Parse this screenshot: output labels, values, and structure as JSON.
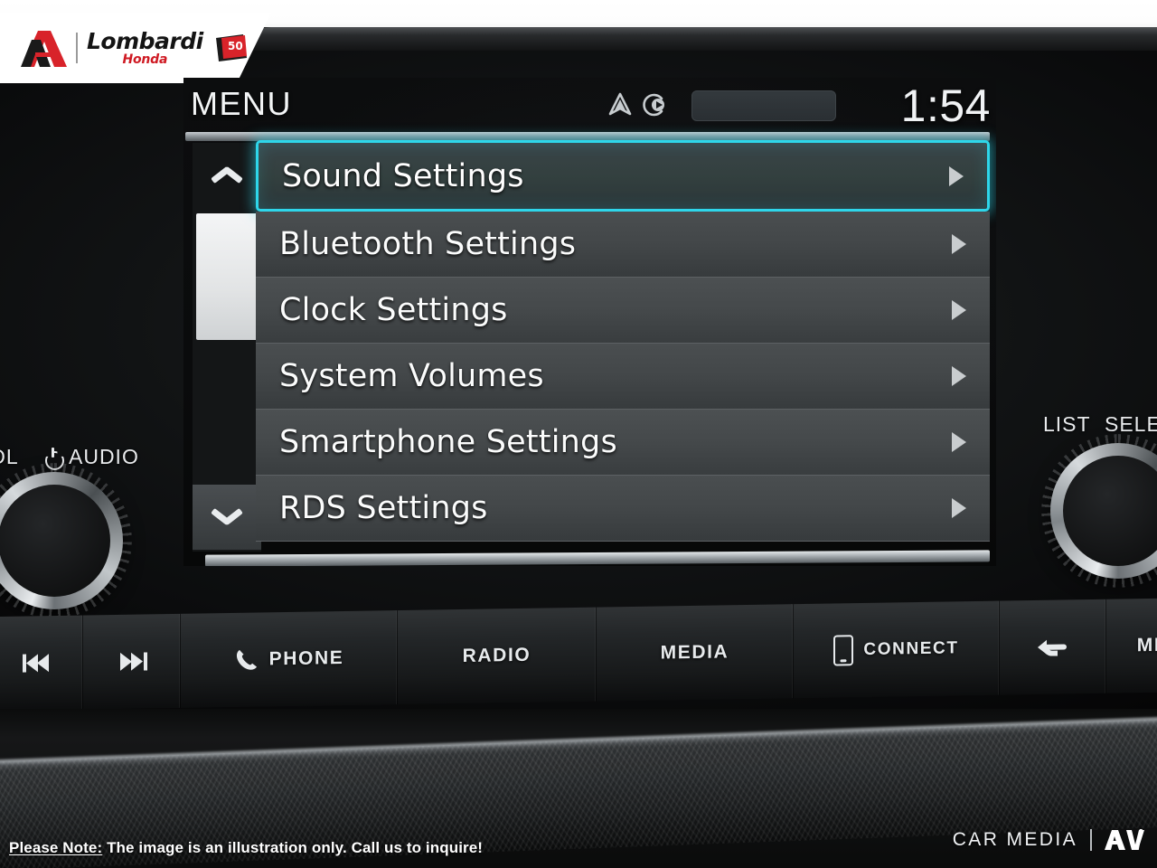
{
  "dealer": {
    "name": "Lombardi",
    "sub": "Honda",
    "anniversary": "50 YEARS",
    "logo_icon": "lombardi-a-monogram-icon"
  },
  "head_unit": {
    "status_bar": {
      "title": "MENU",
      "clock": "1:54",
      "nav_icon": "navigation-arrow-icon",
      "media_icon": "disc-play-icon",
      "info_chip": ""
    },
    "menu": {
      "scroll_up_icon": "chevron-up-icon",
      "scroll_down_icon": "chevron-down-icon",
      "items": [
        {
          "label": "Sound Settings",
          "selected": true,
          "arrow_icon": "chevron-right-icon"
        },
        {
          "label": "Bluetooth Settings",
          "selected": false,
          "arrow_icon": "chevron-right-icon"
        },
        {
          "label": "Clock Settings",
          "selected": false,
          "arrow_icon": "chevron-right-icon"
        },
        {
          "label": "System Volumes",
          "selected": false,
          "arrow_icon": "chevron-right-icon"
        },
        {
          "label": "Smartphone Settings",
          "selected": false,
          "arrow_icon": "chevron-right-icon"
        },
        {
          "label": "RDS Settings",
          "selected": false,
          "arrow_icon": "chevron-right-icon"
        }
      ]
    },
    "accent_color": "#2ed6ea",
    "row_color": "#45494b",
    "screen_bg": "#0a0b0c"
  },
  "controls": {
    "left_knob": {
      "name": "volume-power-knob",
      "label_vol": "OL",
      "label_audio": "AUDIO",
      "power_icon": "power-icon"
    },
    "right_knob": {
      "name": "list-select-knob",
      "label_list": "LIST",
      "label_select": "SELEC"
    }
  },
  "hardkeys": [
    {
      "name": "previous-track-button",
      "label": "",
      "icon": "skip-backward-icon"
    },
    {
      "name": "next-track-button",
      "label": "",
      "icon": "skip-forward-icon"
    },
    {
      "name": "phone-button",
      "label": "PHONE",
      "icon": "phone-handset-icon"
    },
    {
      "name": "radio-button",
      "label": "RADIO",
      "icon": ""
    },
    {
      "name": "media-button",
      "label": "MEDIA",
      "icon": ""
    },
    {
      "name": "connect-button",
      "label": "CONNECT",
      "icon": "smartphone-icon"
    },
    {
      "name": "back-button",
      "label": "",
      "icon": "back-arrow-icon"
    },
    {
      "name": "menu-button",
      "label": "MEN",
      "icon": ""
    }
  ],
  "footer": {
    "note_lead": "Please Note:",
    "note_rest": " The image is an illustration only. Call us to inquire!",
    "brand": "CAR MEDIA",
    "brand_mark_icon": "av-logo-icon"
  }
}
